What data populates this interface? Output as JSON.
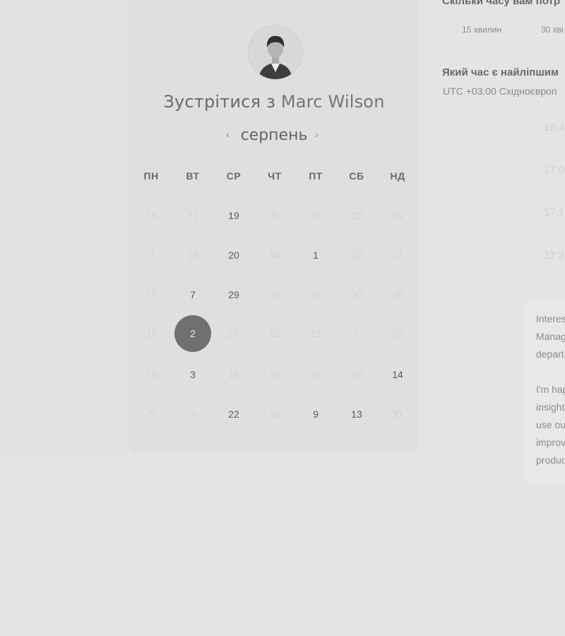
{
  "profile": {
    "title_prefix": "Зустрітися з",
    "name": "Marc Wilson"
  },
  "calendar": {
    "month": "серпень",
    "prev_icon": "‹",
    "next_icon": "›",
    "weekdays": [
      "ПН",
      "ВТ",
      "СР",
      "ЧТ",
      "ПТ",
      "СБ",
      "НД"
    ],
    "weeks": [
      [
        {
          "d": "16",
          "s": "muted"
        },
        {
          "d": "21",
          "s": "muted"
        },
        {
          "d": "19",
          "s": "active"
        },
        {
          "d": "8",
          "s": "muted"
        },
        {
          "d": "27",
          "s": "muted"
        },
        {
          "d": "12",
          "s": "muted"
        },
        {
          "d": "31",
          "s": "muted"
        }
      ],
      [
        {
          "d": "4",
          "s": "muted"
        },
        {
          "d": "16",
          "s": "muted"
        },
        {
          "d": "20",
          "s": "active"
        },
        {
          "d": "14",
          "s": "muted"
        },
        {
          "d": "1",
          "s": "active"
        },
        {
          "d": "12",
          "s": "muted"
        },
        {
          "d": "21",
          "s": "muted"
        }
      ],
      [
        {
          "d": "15",
          "s": "muted"
        },
        {
          "d": "7",
          "s": "active"
        },
        {
          "d": "29",
          "s": "active"
        },
        {
          "d": "25",
          "s": "muted"
        },
        {
          "d": "21",
          "s": "muted"
        },
        {
          "d": "30",
          "s": "muted"
        },
        {
          "d": "26",
          "s": "muted"
        }
      ],
      [
        {
          "d": "15",
          "s": "muted"
        },
        {
          "d": "2",
          "s": "selected"
        },
        {
          "d": "15",
          "s": "muted"
        },
        {
          "d": "12",
          "s": "muted"
        },
        {
          "d": "25",
          "s": "muted"
        },
        {
          "d": "1",
          "s": "muted"
        },
        {
          "d": "25",
          "s": "muted"
        }
      ],
      [
        {
          "d": "18",
          "s": "muted"
        },
        {
          "d": "3",
          "s": "active"
        },
        {
          "d": "15",
          "s": "muted"
        },
        {
          "d": "18",
          "s": "muted"
        },
        {
          "d": "24",
          "s": "muted"
        },
        {
          "d": "28",
          "s": "muted"
        },
        {
          "d": "14",
          "s": "active"
        }
      ],
      [
        {
          "d": "5",
          "s": "muted"
        },
        {
          "d": "9",
          "s": "muted"
        },
        {
          "d": "22",
          "s": "active"
        },
        {
          "d": "10",
          "s": "muted"
        },
        {
          "d": "9",
          "s": "active"
        },
        {
          "d": "13",
          "s": "active"
        },
        {
          "d": "31",
          "s": "muted"
        }
      ]
    ]
  },
  "booking": {
    "duration_question": "Скільки часу вам потр",
    "durations": [
      "15 хвилин",
      "30 хві"
    ],
    "time_question": "Який час є найліпшим",
    "timezone": "UTC +03:00 Східноєвроп",
    "slots": [
      "16:4",
      "17:0",
      "17:1",
      "17:3"
    ]
  },
  "description": {
    "lines": [
      "Interes",
      "Manag",
      "depart",
      "",
      "I'm hap",
      "insight",
      "use ou",
      "improv",
      "produc"
    ]
  },
  "colors": {
    "background": "#e4e4e4",
    "selected_day": "#707070"
  }
}
